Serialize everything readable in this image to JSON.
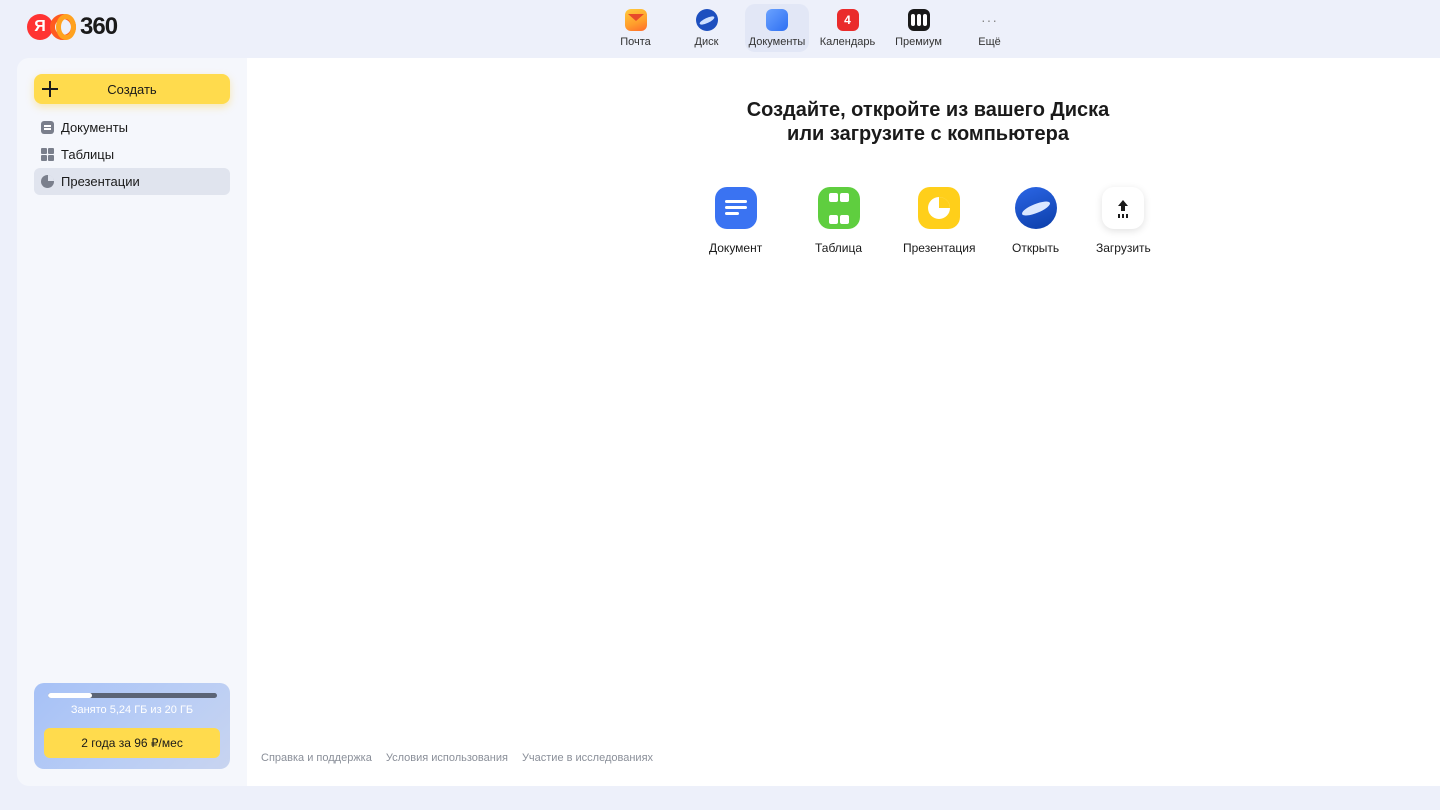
{
  "logo": {
    "mark": "Я",
    "text": "360"
  },
  "services": [
    {
      "label": "Почта",
      "icon": "mail-icon"
    },
    {
      "label": "Диск",
      "icon": "disk-icon"
    },
    {
      "label": "Документы",
      "icon": "docs-icon",
      "active": true
    },
    {
      "label": "Календарь",
      "icon": "calendar-icon",
      "badge": "4"
    },
    {
      "label": "Премиум",
      "icon": "premium-icon"
    },
    {
      "label": "Ещё",
      "icon": "more-icon",
      "glyph": "···"
    }
  ],
  "sidebar": {
    "create_label": "Создать",
    "items": [
      {
        "label": "Документы",
        "icon": "document-icon"
      },
      {
        "label": "Таблицы",
        "icon": "table-icon"
      },
      {
        "label": "Презентации",
        "icon": "presentation-icon",
        "active": true
      }
    ],
    "storage": {
      "text": "Занято 5,24 ГБ из 20 ГБ",
      "used_fraction": 0.262,
      "upgrade_label": "2 года за 96 ₽/мес"
    }
  },
  "main": {
    "headline_line1": "Создайте, откройте из вашего Диска",
    "headline_line2": "или загрузите с компьютера",
    "actions": [
      {
        "label": "Документ",
        "icon": "document-icon",
        "color": "#3a73f2"
      },
      {
        "label": "Таблица",
        "icon": "table-icon",
        "color": "#5fce3f"
      },
      {
        "label": "Презентация",
        "icon": "presentation-icon",
        "color": "#ffcf1a"
      },
      {
        "label": "Открыть",
        "icon": "disk-icon",
        "color": "#1d4fbf"
      },
      {
        "label": "Загрузить",
        "icon": "upload-icon",
        "color": "#ffffff"
      }
    ]
  },
  "footer": {
    "links": [
      "Справка и поддержка",
      "Условия использования",
      "Участие в исследованиях"
    ]
  },
  "colors": {
    "accent": "#ffdb4d",
    "background": "#edf0fa"
  }
}
